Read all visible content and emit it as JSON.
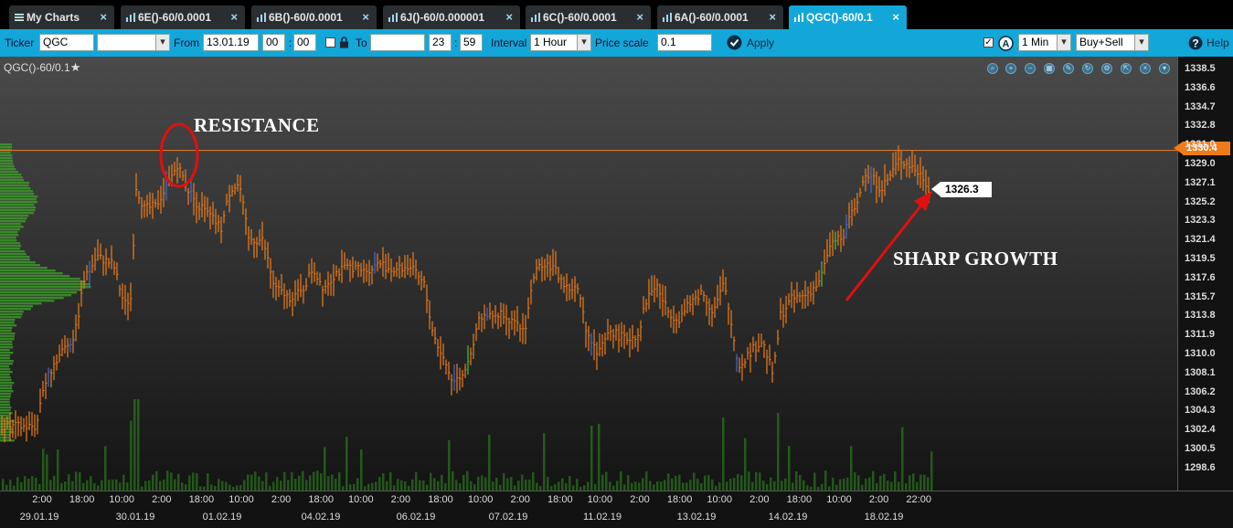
{
  "tabs": [
    {
      "label": "My Charts",
      "icon": "menu-icon",
      "active": false
    },
    {
      "label": "6E()-60/0.0001",
      "icon": "bar-chart-icon",
      "active": false
    },
    {
      "label": "6B()-60/0.0001",
      "icon": "bar-chart-icon",
      "active": false
    },
    {
      "label": "6J()-60/0.000001",
      "icon": "bar-chart-icon",
      "active": false
    },
    {
      "label": "6C()-60/0.0001",
      "icon": "bar-chart-icon",
      "active": false
    },
    {
      "label": "6A()-60/0.0001",
      "icon": "bar-chart-icon",
      "active": false
    },
    {
      "label": "QGC()-60/0.1",
      "icon": "bar-chart-icon",
      "active": true
    }
  ],
  "toolbar": {
    "ticker_label": "Ticker",
    "ticker_value": "QGC",
    "from_label": "From",
    "from_date": "13.01.19",
    "from_hour": "00",
    "from_min": "00",
    "to_label": "To",
    "to_hour": "23",
    "to_min": "59",
    "interval_label": "Interval",
    "interval_value": "1 Hour",
    "price_scale_label": "Price scale",
    "price_scale_value": "0.1",
    "apply_label": "Apply",
    "timeframe_value": "1 Min",
    "side_value": "Buy+Sell",
    "help_label": "Help",
    "accent_color": "#12a7d8"
  },
  "chart": {
    "title": "QGC()-60/0.1",
    "resistance_label": "RESISTANCE",
    "growth_label": "SHARP GROWTH",
    "resistance_price": "1330.4",
    "last_price": "1326.3",
    "bar_color": "#ef7c19",
    "volume_color": "#2f8f1f",
    "annotation_color": "#e01010"
  },
  "chart_data": {
    "type": "candlestick",
    "y_ticks": [
      "1338.5",
      "1336.6",
      "1334.7",
      "1332.8",
      "1331.0",
      "1329.0",
      "1327.1",
      "1325.2",
      "1323.3",
      "1321.4",
      "1319.5",
      "1317.6",
      "1315.7",
      "1313.8",
      "1311.9",
      "1310.0",
      "1308.1",
      "1306.2",
      "1304.3",
      "1302.4",
      "1300.5",
      "1298.6"
    ],
    "ylim": [
      1297.0,
      1339.9
    ],
    "x_time_labels": [
      "2:00",
      "18:00",
      "10:00",
      "2:00",
      "18:00",
      "10:00",
      "2:00",
      "18:00",
      "10:00",
      "2:00",
      "18:00",
      "10:00",
      "2:00",
      "18:00",
      "10:00",
      "2:00",
      "18:00",
      "10:00",
      "2:00",
      "18:00",
      "10:00",
      "2:00",
      "22:00"
    ],
    "x_date_labels": [
      "29.01.19",
      "30.01.19",
      "01.02.19",
      "04.02.19",
      "06.02.19",
      "07.02.19",
      "11.02.19",
      "13.02.19",
      "14.02.19",
      "18.02.19"
    ],
    "price_path": [
      [
        0,
        1302.8
      ],
      [
        40,
        1302.8
      ],
      [
        46,
        1306.4
      ],
      [
        60,
        1309.3
      ],
      [
        82,
        1312.0
      ],
      [
        92,
        1317.4
      ],
      [
        106,
        1319.8
      ],
      [
        124,
        1319.0
      ],
      [
        136,
        1315.0
      ],
      [
        144,
        1315.7
      ],
      [
        148,
        1327.0
      ],
      [
        158,
        1324.6
      ],
      [
        170,
        1324.8
      ],
      [
        182,
        1326.7
      ],
      [
        194,
        1329.0
      ],
      [
        206,
        1326.5
      ],
      [
        216,
        1325.0
      ],
      [
        228,
        1324.0
      ],
      [
        242,
        1322.6
      ],
      [
        252,
        1326.6
      ],
      [
        262,
        1327.0
      ],
      [
        272,
        1321.5
      ],
      [
        288,
        1321.4
      ],
      [
        300,
        1316.7
      ],
      [
        316,
        1315.7
      ],
      [
        330,
        1316.2
      ],
      [
        342,
        1318.6
      ],
      [
        354,
        1316.7
      ],
      [
        368,
        1318.2
      ],
      [
        384,
        1318.8
      ],
      [
        398,
        1318.3
      ],
      [
        416,
        1319.1
      ],
      [
        430,
        1318.4
      ],
      [
        448,
        1318.8
      ],
      [
        464,
        1317.0
      ],
      [
        474,
        1312.0
      ],
      [
        486,
        1309.4
      ],
      [
        496,
        1307.2
      ],
      [
        506,
        1307.9
      ],
      [
        516,
        1310.8
      ],
      [
        526,
        1313.9
      ],
      [
        538,
        1313.8
      ],
      [
        552,
        1314.2
      ],
      [
        562,
        1313.0
      ],
      [
        574,
        1312.4
      ],
      [
        584,
        1317.9
      ],
      [
        594,
        1319.3
      ],
      [
        606,
        1318.6
      ],
      [
        620,
        1316.6
      ],
      [
        632,
        1316.5
      ],
      [
        642,
        1312.4
      ],
      [
        654,
        1309.9
      ],
      [
        668,
        1312.4
      ],
      [
        684,
        1311.5
      ],
      [
        698,
        1312.0
      ],
      [
        708,
        1315.7
      ],
      [
        718,
        1317.0
      ],
      [
        730,
        1314.4
      ],
      [
        742,
        1313.5
      ],
      [
        756,
        1315.2
      ],
      [
        768,
        1316.3
      ],
      [
        780,
        1314.2
      ],
      [
        792,
        1317.1
      ],
      [
        800,
        1313.0
      ],
      [
        808,
        1308.8
      ],
      [
        822,
        1310.4
      ],
      [
        834,
        1311.4
      ],
      [
        846,
        1307.9
      ],
      [
        854,
        1313.9
      ],
      [
        866,
        1315.5
      ],
      [
        880,
        1315.9
      ],
      [
        896,
        1317.1
      ],
      [
        910,
        1321.4
      ],
      [
        924,
        1322.1
      ],
      [
        936,
        1325.1
      ],
      [
        950,
        1328.1
      ],
      [
        964,
        1326.6
      ],
      [
        972,
        1327.6
      ],
      [
        984,
        1329.5
      ],
      [
        996,
        1328.9
      ],
      [
        1010,
        1327.7
      ],
      [
        1018,
        1326.3
      ]
    ],
    "volume_profile": "left-side horizontal histogram",
    "volume_bars": "bottom vertical histogram"
  },
  "icons": {
    "toolbar": [
      "zoom-fit-icon",
      "zoom-in-icon",
      "zoom-out-icon",
      "grid-icon",
      "draw-icon",
      "refresh-icon",
      "settings-icon",
      "popout-icon",
      "close-icon",
      "chevron-down-icon"
    ]
  }
}
